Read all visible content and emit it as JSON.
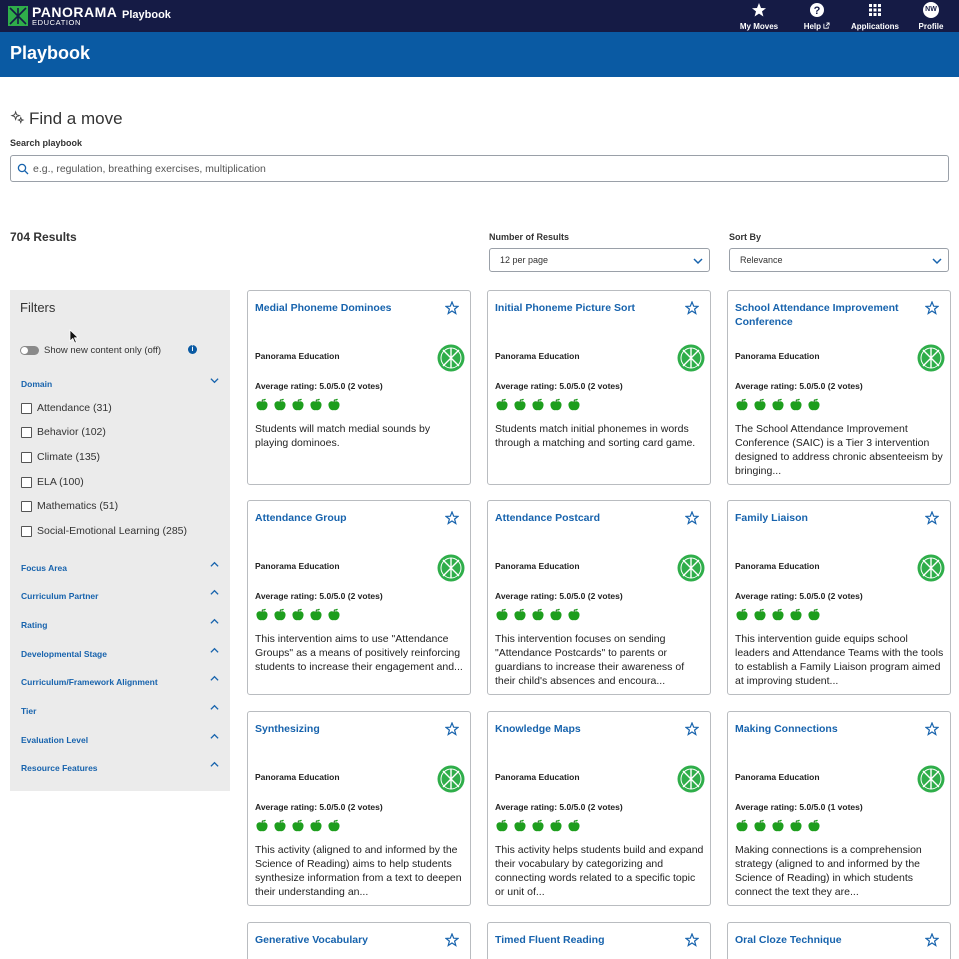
{
  "app": {
    "logo_word": "PANORAMA",
    "logo_sub": "EDUCATION",
    "name": "Playbook",
    "colors": {
      "navbar": "#151b45",
      "header": "#0a5aa3",
      "link": "#1763ad",
      "apple": "#1e9e1e",
      "badge": "#2fae4a"
    }
  },
  "nav": [
    {
      "label": "My Moves",
      "icon": "star-icon"
    },
    {
      "label": "Help",
      "icon": "help-circle-icon",
      "extra_icon": "external-link-icon"
    },
    {
      "label": "Applications",
      "icon": "grid-icon"
    },
    {
      "label": "Profile",
      "icon": "avatar",
      "initials": "NW"
    }
  ],
  "header": {
    "title": "Playbook"
  },
  "find": {
    "title": "Find a move",
    "icon": "sparkle-icon",
    "search_label": "Search playbook",
    "search_placeholder": "e.g., regulation, breathing exercises, multiplication",
    "search_value": ""
  },
  "results": {
    "count_text": "704 Results",
    "per_page_label": "Number of Results",
    "per_page_value": "12 per page",
    "sort_label": "Sort By",
    "sort_value": "Relevance"
  },
  "filters": {
    "title": "Filters",
    "toggle_label": "Show new content only (off)",
    "toggle_on": false,
    "domain": {
      "label": "Domain",
      "expanded": true,
      "options": [
        {
          "label": "Attendance (31)",
          "checked": false
        },
        {
          "label": "Behavior (102)",
          "checked": false
        },
        {
          "label": "Climate (135)",
          "checked": false
        },
        {
          "label": "ELA (100)",
          "checked": false
        },
        {
          "label": "Mathematics (51)",
          "checked": false
        },
        {
          "label": "Social-Emotional Learning (285)",
          "checked": false
        }
      ]
    },
    "sections": [
      "Focus Area",
      "Curriculum Partner",
      "Rating",
      "Developmental Stage",
      "Curriculum/Framework Alignment",
      "Tier",
      "Evaluation Level",
      "Resource Features"
    ]
  },
  "cards": [
    {
      "title": "Medial Phoneme Dominoes",
      "author": "Panorama Education",
      "rating_text": "Average rating: 5.0/5.0 (2 votes)",
      "rating": 5,
      "description": "Students will match medial sounds by playing dominoes."
    },
    {
      "title": "Initial Phoneme Picture Sort",
      "author": "Panorama Education",
      "rating_text": "Average rating: 5.0/5.0 (2 votes)",
      "rating": 5,
      "description": "Students match initial phonemes in words through a matching and sorting card game."
    },
    {
      "title": "School Attendance Improvement Conference",
      "author": "Panorama Education",
      "rating_text": "Average rating: 5.0/5.0 (2 votes)",
      "rating": 5,
      "description": "The School Attendance Improvement Conference (SAIC) is a Tier 3 intervention designed to address chronic absenteeism by bringing..."
    },
    {
      "title": "Attendance Group",
      "author": "Panorama Education",
      "rating_text": "Average rating: 5.0/5.0 (2 votes)",
      "rating": 5,
      "description": "This intervention aims to use \"Attendance Groups\" as a means of positively reinforcing students to increase their engagement and..."
    },
    {
      "title": "Attendance Postcard",
      "author": "Panorama Education",
      "rating_text": "Average rating: 5.0/5.0 (2 votes)",
      "rating": 5,
      "description": "This intervention focuses on sending \"Attendance Postcards\" to parents or guardians to increase their awareness of their child's absences and encoura..."
    },
    {
      "title": "Family Liaison",
      "author": "Panorama Education",
      "rating_text": "Average rating: 5.0/5.0 (2 votes)",
      "rating": 5,
      "description": "This intervention guide equips school leaders and Attendance Teams with the tools to establish a Family Liaison program aimed at improving student..."
    },
    {
      "title": "Synthesizing",
      "author": "Panorama Education",
      "rating_text": "Average rating: 5.0/5.0 (2 votes)",
      "rating": 5,
      "description": "This activity (aligned to and informed by the Science of Reading) aims to help students synthesize information from a text to deepen their understanding an..."
    },
    {
      "title": "Knowledge Maps",
      "author": "Panorama Education",
      "rating_text": "Average rating: 5.0/5.0 (2 votes)",
      "rating": 5,
      "description": "This activity helps students build and expand their vocabulary by categorizing and connecting words related to a specific topic or unit of..."
    },
    {
      "title": "Making Connections",
      "author": "Panorama Education",
      "rating_text": "Average rating: 5.0/5.0 (1 votes)",
      "rating": 5,
      "description": "Making connections is a comprehension strategy (aligned to and informed by the Science of Reading) in which students connect the text they are..."
    },
    {
      "title": "Generative Vocabulary"
    },
    {
      "title": "Timed Fluent Reading"
    },
    {
      "title": "Oral Cloze Technique"
    }
  ]
}
